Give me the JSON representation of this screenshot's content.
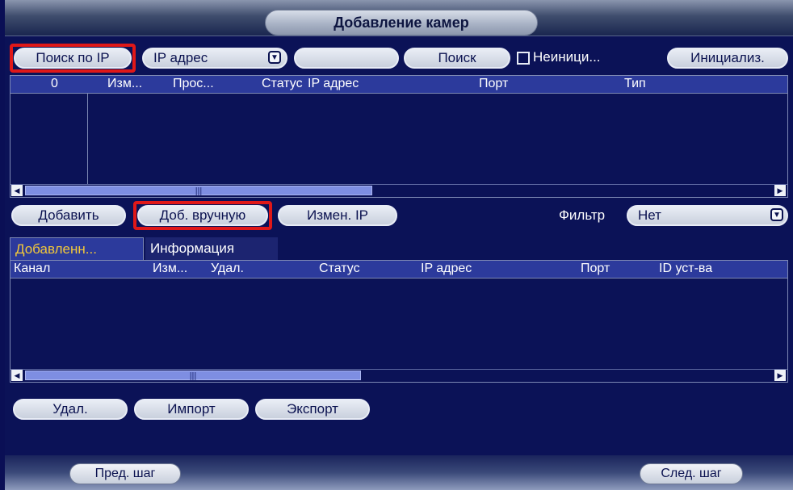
{
  "window": {
    "title": "Добавление камер"
  },
  "search_bar": {
    "search_by_ip_label": "Поиск по IP",
    "ip_type_selected": "IP адрес",
    "ip_value": "",
    "search_label": "Поиск",
    "uninit_checkbox_label": "Неиници...",
    "uninit_checked": false,
    "initialize_label": "Инициализ."
  },
  "found_table": {
    "columns": [
      "0",
      "Изм...",
      "Прос...",
      "Статус",
      "IP адрес",
      "Порт",
      "Тип"
    ],
    "rows": []
  },
  "found_actions": {
    "add_label": "Добавить",
    "manual_add_label": "Доб. вручную",
    "change_ip_label": "Измен. IP",
    "filter_label": "Фильтр",
    "filter_value": "Нет"
  },
  "tabs": [
    {
      "label": "Добавленн...",
      "active": true
    },
    {
      "label": "Информация",
      "active": false
    }
  ],
  "added_table": {
    "columns": [
      "Канал",
      "Изм...",
      "Удал.",
      "Статус",
      "IP адрес",
      "Порт",
      "ID уст-ва"
    ],
    "rows": []
  },
  "added_actions": {
    "delete_label": "Удал.",
    "import_label": "Импорт",
    "export_label": "Экспорт"
  },
  "footer": {
    "prev_label": "Пред. шаг",
    "next_label": "След. шаг"
  },
  "colors": {
    "background": "#0b1257",
    "header_row": "#2c3a9c",
    "highlight": "#e01818",
    "active_tab_text": "#f2c83a"
  }
}
